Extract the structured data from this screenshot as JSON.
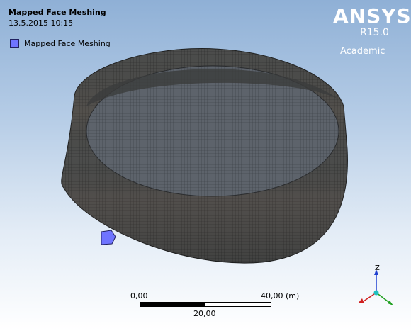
{
  "title": "Mapped Face Meshing",
  "timestamp": "13.5.2015 10:15",
  "legend": {
    "label": "Mapped Face Meshing",
    "color": "#6f74ff"
  },
  "logo": {
    "brand": "ANSYS",
    "version": "R15.0",
    "edition": "Academic"
  },
  "scale": {
    "left": "0,00",
    "right": "40,00 (m)",
    "mid": "20,00"
  },
  "triad": {
    "z_label": "Z",
    "colors": {
      "x": "#d02020",
      "y": "#20a020",
      "z": "#2040d0",
      "origin": "#20c0c0"
    }
  },
  "colors": {
    "mesh_dark": "#4a4a48",
    "mesh_light": "#6a6f76"
  }
}
